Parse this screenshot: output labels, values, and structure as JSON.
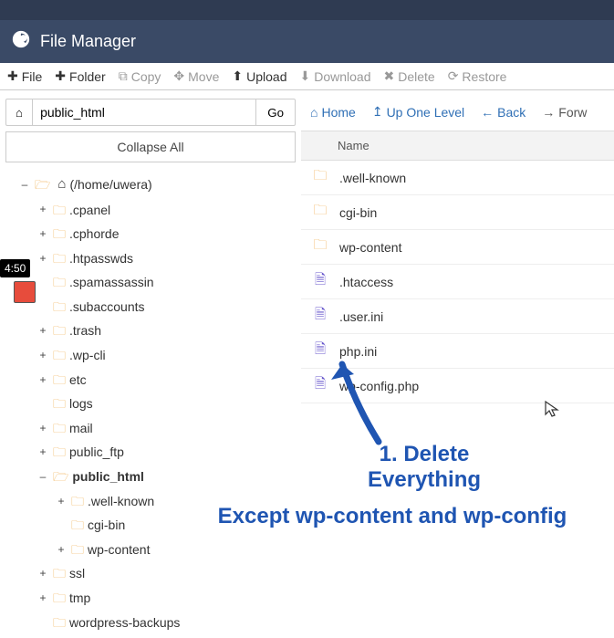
{
  "header": {
    "title": "File Manager"
  },
  "toolbar": {
    "file": "File",
    "folder": "Folder",
    "copy": "Copy",
    "move": "Move",
    "upload": "Upload",
    "download": "Download",
    "delete": "Delete",
    "restore": "Restore"
  },
  "left": {
    "path": "public_html",
    "go": "Go",
    "collapse": "Collapse All",
    "root": "(/home/uwera)",
    "tree": [
      {
        "label": ".cpanel",
        "indent": 1,
        "exp": "+"
      },
      {
        "label": ".cphorde",
        "indent": 1,
        "exp": "+"
      },
      {
        "label": ".htpasswds",
        "indent": 1,
        "exp": "+"
      },
      {
        "label": ".spamassassin",
        "indent": 1,
        "exp": ""
      },
      {
        "label": ".subaccounts",
        "indent": 1,
        "exp": ""
      },
      {
        "label": ".trash",
        "indent": 1,
        "exp": "+"
      },
      {
        "label": ".wp-cli",
        "indent": 1,
        "exp": "+"
      },
      {
        "label": "etc",
        "indent": 1,
        "exp": "+"
      },
      {
        "label": "logs",
        "indent": 1,
        "exp": ""
      },
      {
        "label": "mail",
        "indent": 1,
        "exp": "+"
      },
      {
        "label": "public_ftp",
        "indent": 1,
        "exp": "+"
      },
      {
        "label": "public_html",
        "indent": 1,
        "exp": "–",
        "selected": true,
        "open": true
      },
      {
        "label": ".well-known",
        "indent": 2,
        "exp": "+"
      },
      {
        "label": "cgi-bin",
        "indent": 2,
        "exp": ""
      },
      {
        "label": "wp-content",
        "indent": 2,
        "exp": "+"
      },
      {
        "label": "ssl",
        "indent": 1,
        "exp": "+"
      },
      {
        "label": "tmp",
        "indent": 1,
        "exp": "+"
      },
      {
        "label": "wordpress-backups",
        "indent": 1,
        "exp": ""
      }
    ]
  },
  "nav": {
    "home": "Home",
    "up": "Up One Level",
    "back": "Back",
    "forward": "Forw"
  },
  "list": {
    "header_name": "Name",
    "rows": [
      {
        "name": ".well-known",
        "type": "folder"
      },
      {
        "name": "cgi-bin",
        "type": "folder"
      },
      {
        "name": "wp-content",
        "type": "folder"
      },
      {
        "name": ".htaccess",
        "type": "file"
      },
      {
        "name": ".user.ini",
        "type": "file"
      },
      {
        "name": "php.ini",
        "type": "file"
      },
      {
        "name": "wp-config.php",
        "type": "file"
      }
    ]
  },
  "badge": {
    "time": "4:50"
  },
  "annotation": {
    "line1": "1. Delete Everything",
    "line2": "Except wp-content and wp-config"
  }
}
